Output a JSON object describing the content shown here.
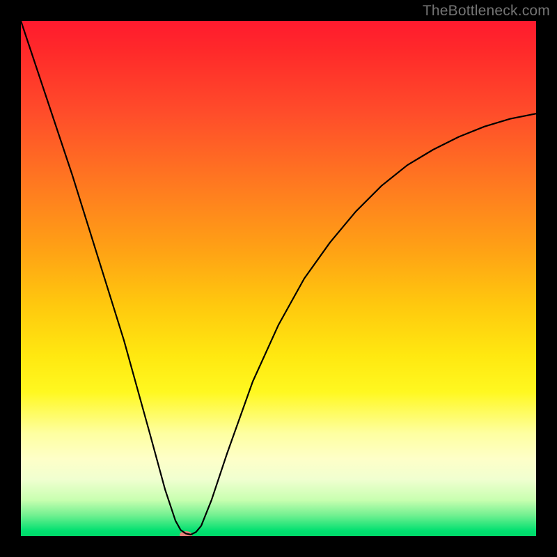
{
  "watermark": "TheBottleneck.com",
  "chart_data": {
    "type": "line",
    "title": "",
    "xlabel": "",
    "ylabel": "",
    "xlim": [
      0,
      100
    ],
    "ylim": [
      0,
      100
    ],
    "grid": false,
    "background": "rainbow-gradient-vertical",
    "series": [
      {
        "name": "bottleneck-curve",
        "x": [
          0,
          5,
          10,
          15,
          20,
          25,
          28,
          30,
          31,
          32,
          33,
          34,
          35,
          37,
          40,
          45,
          50,
          55,
          60,
          65,
          70,
          75,
          80,
          85,
          90,
          95,
          100
        ],
        "y": [
          100,
          85,
          70,
          54,
          38,
          20,
          9,
          3,
          1.2,
          0.5,
          0.3,
          0.8,
          2,
          7,
          16,
          30,
          41,
          50,
          57,
          63,
          68,
          72,
          75,
          77.5,
          79.5,
          81,
          82
        ],
        "color": "#000000",
        "stroke_width": 2
      }
    ],
    "marker": {
      "name": "optimal-point",
      "x": 32,
      "y": 0.3,
      "color": "#e8817a"
    },
    "gradient_stops": [
      {
        "pos": 0,
        "color": "#ff1a2e"
      },
      {
        "pos": 50,
        "color": "#ffd400"
      },
      {
        "pos": 85,
        "color": "#feffc0"
      },
      {
        "pos": 100,
        "color": "#00d868"
      }
    ]
  }
}
